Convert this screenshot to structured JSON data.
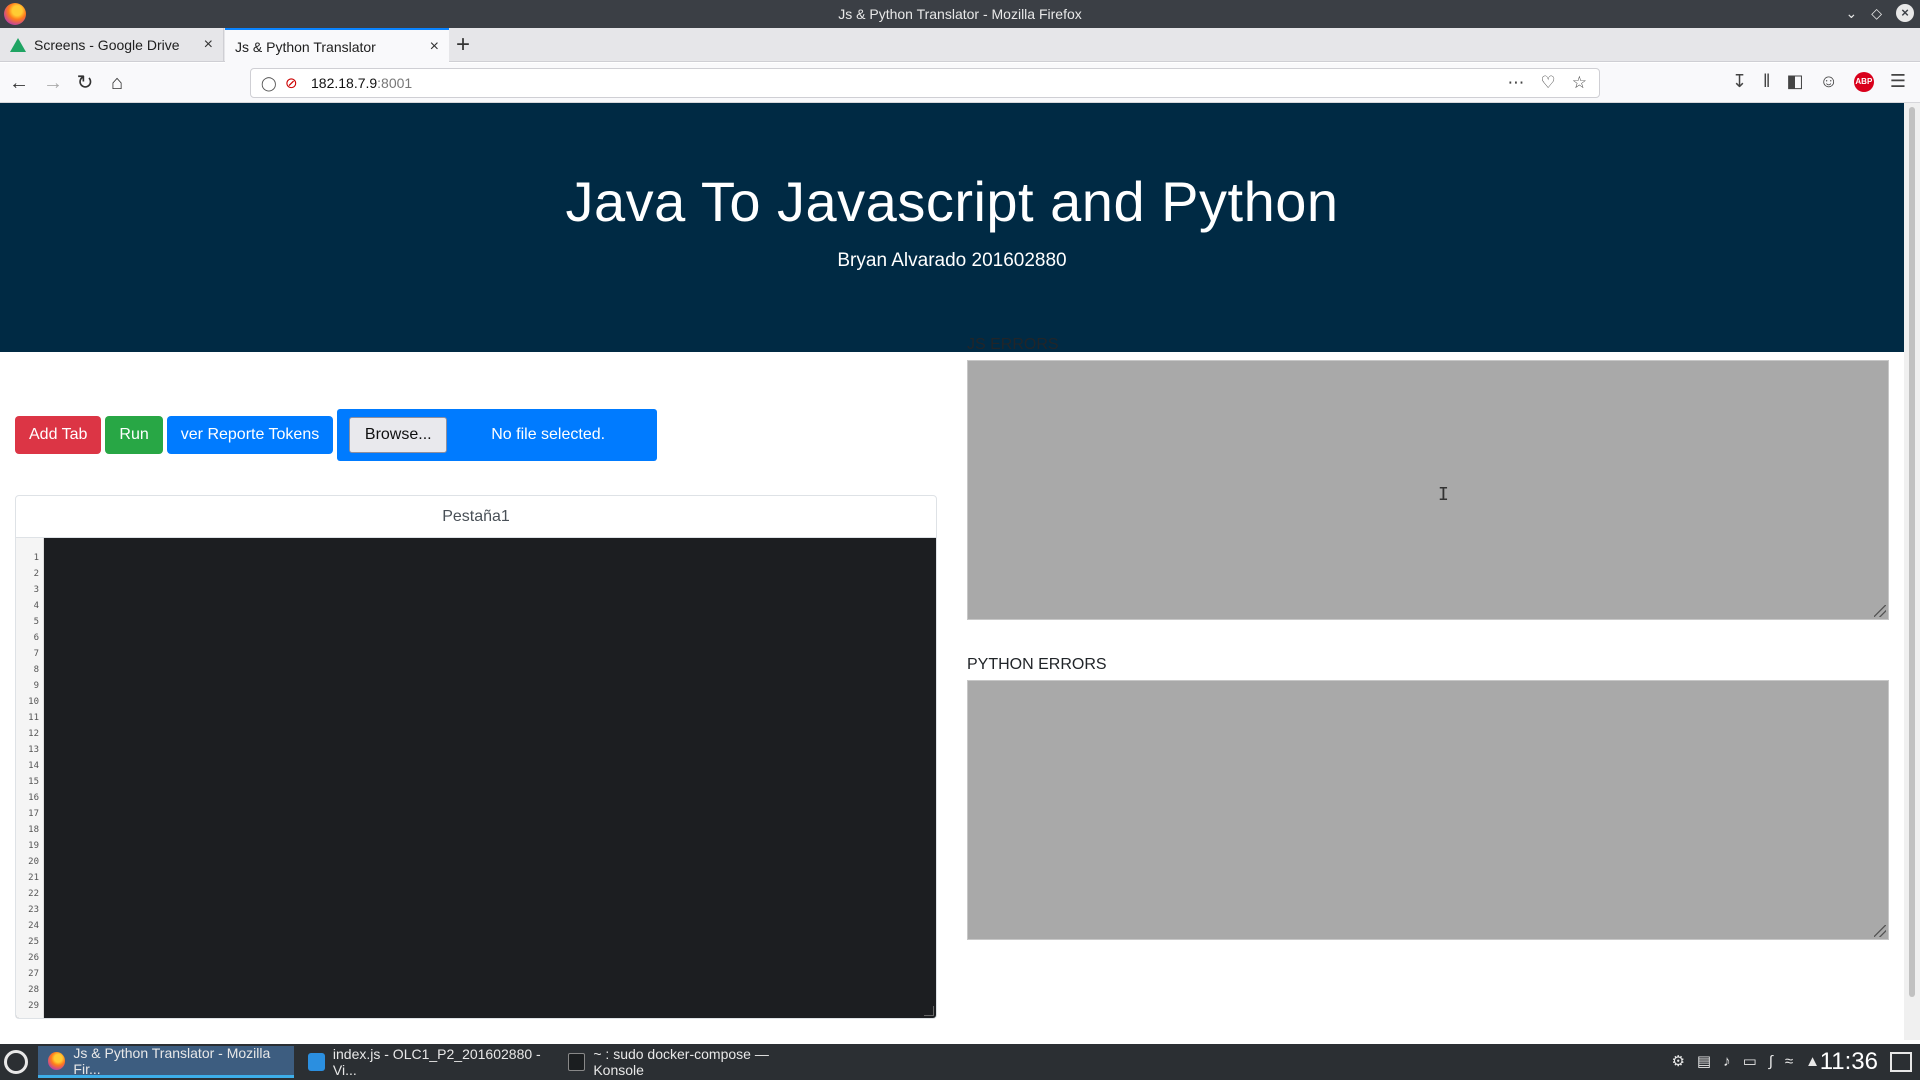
{
  "window": {
    "title": "Js & Python Translator - Mozilla Firefox"
  },
  "tabs": [
    {
      "label": "Screens - Google Drive"
    },
    {
      "label": "Js & Python Translator"
    }
  ],
  "address": {
    "host": "182.18.7.9",
    "port": ":8001"
  },
  "hero": {
    "title": "Java To Javascript and Python",
    "subtitle": "Bryan Alvarado 201602880"
  },
  "actions": {
    "add_tab": "Add Tab",
    "run": "Run",
    "report_tokens": "ver Reporte Tokens",
    "browse": "Browse...",
    "file_status": "No file selected."
  },
  "editor": {
    "tab_label": "Pestaña1",
    "line_numbers": [
      "1",
      "2",
      "3",
      "4",
      "5",
      "6",
      "7",
      "8",
      "9",
      "10",
      "11",
      "12",
      "13",
      "14",
      "15",
      "16",
      "17",
      "18",
      "19",
      "20",
      "21",
      "22",
      "23",
      "24",
      "25",
      "26",
      "27",
      "28",
      "29"
    ]
  },
  "errors": {
    "js_label": "JS ERRORS",
    "python_label": "PYTHON ERRORS"
  },
  "taskbar": {
    "items": [
      {
        "label": "Js & Python Translator - Mozilla Fir..."
      },
      {
        "label": "index.js - OLC1_P2_201602880 - Vi..."
      },
      {
        "label": "~ : sudo docker-compose — Konsole"
      }
    ],
    "clock": "11:36"
  },
  "colors": {
    "hero_bg": "#002a44",
    "add_tab": "#dc3545",
    "run": "#28a745",
    "report": "#007bff",
    "error_box": "#a9a9a9",
    "editor_bg": "#1c1e21"
  }
}
